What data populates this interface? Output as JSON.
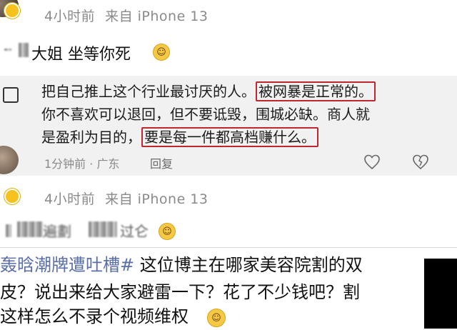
{
  "post1": {
    "time": "4小时前",
    "source": "来自 iPhone 13"
  },
  "reply1": {
    "text": "大姐 坐等你死"
  },
  "quoted_comment": {
    "line1_plain": "把自己推上这个行业最讨厌的人。",
    "line1_highlight": "被网暴是正常的。",
    "line2": "你不喜欢可以退回，但不要诋毁，围城必缺。商人就",
    "line3_plain": "是盈利为目的，",
    "line3_highlight": "要是每一件都高档赚什么。",
    "time": "1分钟前 · 广东",
    "reply_label": "回复"
  },
  "post2": {
    "time": "4小时前",
    "source": "来自 iPhone 13"
  },
  "reply2": {
    "text_fragment": "遍劃",
    "text_fragment2": "过仑"
  },
  "bottom_post": {
    "hashtag": "轰晗潮牌遭吐槽#",
    "line1_rest": " 这位博主在哪家美容院割的双",
    "line2": "皮？说出来给大家避雷一下？花了不少钱吧？割",
    "line3": "这样怎么不录个视频维权"
  },
  "icons": {
    "like": "heart-outline-icon",
    "dislike": "broken-heart-icon",
    "emoji": "smiling-face-icon",
    "badge": "vip-badge-icon"
  },
  "colors": {
    "highlight_border": "#c0262d",
    "hashtag": "#5a6fa8",
    "quote_background": "#f1f1f1"
  }
}
